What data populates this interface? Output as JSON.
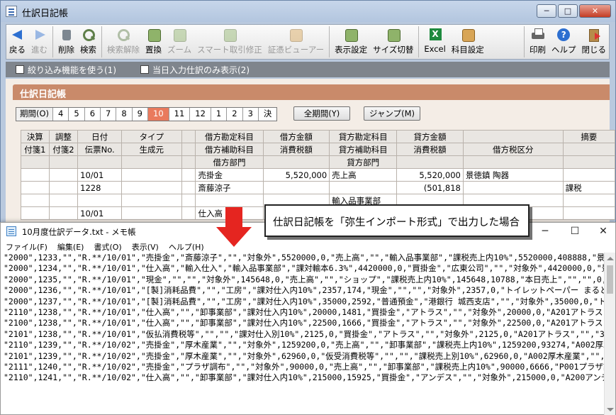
{
  "main_window": {
    "title": "仕訳日記帳",
    "controls": {
      "minimize": "─",
      "maximize": "□",
      "close": "✕"
    }
  },
  "toolbar": {
    "left": [
      {
        "label": "戻る",
        "icon": "back-arrow-icon",
        "disabled": false
      },
      {
        "label": "進む",
        "icon": "forward-arrow-icon",
        "disabled": true
      },
      {
        "label": "削除",
        "icon": "trash-icon",
        "disabled": false
      },
      {
        "label": "検索",
        "icon": "search-icon",
        "disabled": false
      },
      {
        "label": "検索解除",
        "icon": "search-clear-icon",
        "disabled": true
      },
      {
        "label": "置換",
        "icon": "replace-icon",
        "disabled": false
      },
      {
        "label": "ズーム",
        "icon": "zoom-icon",
        "disabled": true
      },
      {
        "label": "スマート取引修正",
        "icon": "smart-edit-icon",
        "disabled": true
      },
      {
        "label": "証憑ビューアー",
        "icon": "viewer-icon",
        "disabled": true
      },
      {
        "label": "表示設定",
        "icon": "display-settings-icon",
        "disabled": false
      },
      {
        "label": "サイズ切替",
        "icon": "size-toggle-icon",
        "disabled": false
      },
      {
        "label": "Excel",
        "icon": "excel-icon",
        "disabled": false
      },
      {
        "label": "科目設定",
        "icon": "account-settings-icon",
        "disabled": false
      }
    ],
    "right": [
      {
        "label": "印刷",
        "icon": "print-icon",
        "disabled": false
      },
      {
        "label": "ヘルプ",
        "icon": "help-icon",
        "disabled": false
      },
      {
        "label": "閉じる",
        "icon": "exit-icon",
        "disabled": false
      }
    ]
  },
  "options": {
    "filter": "絞り込み機能を使う(1)",
    "today_only": "当日入力仕訳のみ表示(2)"
  },
  "section_title": "仕訳日記帳",
  "periods": {
    "label": "期間(O)",
    "months": [
      "4",
      "5",
      "6",
      "7",
      "8",
      "9",
      "10",
      "11",
      "12",
      "1",
      "2",
      "3",
      "決"
    ],
    "active": "10",
    "all_button": "全期間(Y)",
    "jump_button": "ジャンプ(M)"
  },
  "ledger": {
    "header_row1": [
      "決算",
      "調整",
      "日付",
      "タイプ",
      "",
      "借方勘定科目",
      "借方金額",
      "貸方勘定科目",
      "貸方金額",
      "",
      "摘要"
    ],
    "header_row2": [
      "付箋1",
      "付箋2",
      "伝票No.",
      "生成元",
      "",
      "借方補助科目",
      "消費税額",
      "貸方補助科目",
      "消費税額",
      "借方税区分",
      ""
    ],
    "header_row3": [
      "",
      "",
      "",
      "",
      "",
      "借方部門",
      "",
      "貸方部門",
      "",
      "",
      ""
    ],
    "rows": [
      [
        "",
        "",
        "10/01",
        "",
        "",
        "売掛金",
        "5,520,000",
        "売上高",
        "5,520,000",
        "景徳鎮 陶器",
        ""
      ],
      [
        "",
        "",
        "1228",
        "",
        "",
        "斎藤涼子",
        "",
        "",
        "(501,818",
        "",
        "課税"
      ],
      [
        "",
        "",
        "",
        "",
        "",
        "",
        "",
        "輸入品事業部",
        "",
        "",
        ""
      ],
      [
        "",
        "",
        "10/01",
        "",
        "",
        "仕入高",
        "",
        "",
        "",
        "",
        ""
      ]
    ]
  },
  "callout": "仕訳日記帳を「弥生インポート形式」で出力した場合",
  "notepad": {
    "title": "10月度仕訳データ.txt - メモ帳",
    "menu": [
      "ファイル(F)",
      "編集(E)",
      "書式(O)",
      "表示(V)",
      "ヘルプ(H)"
    ],
    "controls": {
      "minimize": "─",
      "maximize": "☐",
      "close": "✕"
    },
    "lines": [
      "\"2000\",1233,\"\",\"R.**/10/01\",\"売掛金\",\"斎藤涼子\",\"\",\"対象外\",5520000,0,\"売上高\",\"\",\"輸入品事業部\",\"課税売上内10%\",5520000,408888,\"景",
      "\"2000\",1234,\"\",\"R.**/10/01\",\"仕入高\",\"輸入仕入\",\"輸入品事業部\",\"課対輸本6.3%\",4420000,0,\"買掛金\",\"広東公司\",\"\",\"対象外\",4420000,0,\"景",
      "\"2000\",1235,\"\",\"R.**/10/01\",\"現金\",\"\",\"\",\"対象外\",145648,0,\"売上高\",\"\",\"ショップ\",\"課税売上内10%\",145648,10788,\"本日売上\",\"\",\"\",0,\"\",\"\",",
      "\"2000\",1236,\"\",\"R.**/10/01\",\"[製]消耗品費\",\"\",\"工房\",\"課対仕入内10%\",2357,174,\"現金\",\"\",\"\",\"対象外\",2357,0,\"トイレットペーパー まると",
      "\"2000\",1237,\"\",\"R.**/10/01\",\"[製]消耗品費\",\"\",\"工房\",\"課対仕入内10%\",35000,2592,\"普通預金\",\"港銀行 城西支店\",\"\",\"対象外\",35000,0,\"ト",
      "\"2110\",1238,\"\",\"R.**/10/01\",\"仕入高\",\"\",\"卸事業部\",\"課対仕入内10%\",20000,1481,\"買掛金\",\"アトラス\",\"\",\"対象外\",20000,0,\"A201アトラス",
      "\"2100\",1238,\"\",\"R.**/10/01\",\"仕入高\",\"\",\"卸事業部\",\"課対仕入内10%\",22500,1666,\"買掛金\",\"アトラス\",\"\",\"対象外\",22500,0,\"A201アトラス",
      "\"2101\",1238,\"\",\"R.**/10/01\",\"仮払消費税等\",\"\",\"\",\"課対仕入別10%\",2125,0,\"買掛金\",\"アトラス\",\"\",\"対象外\",2125,0,\"A201アトラス\",\"\",\"3,\"",
      "\"2110\",1239,\"\",\"R.**/10/02\",\"売掛金\",\"厚木産業\",\"\",\"対象外\",1259200,0,\"売上高\",\"\",\"卸事業部\",\"課税売上内10%\",1259200,93274,\"A002厚木",
      "\"2101\",1239,\"\",\"R.**/10/02\",\"売掛金\",\"厚木産業\",\"\",\"対象外\",62960,0,\"仮受消費税等\",\"\",\"\",\"課税売上別10%\",62960,0,\"A002厚木産業\",\"\",",
      "\"2111\",1240,\"\",\"R.**/10/02\",\"売掛金\",\"プラザ調布\",\"\",\"対象外\",90000,0,\"売上高\",\"\",\"卸事業部\",\"課税売上内10%\",90000,6666,\"P001プラザ調",
      "\"2110\",1241,\"\",\"R.**/10/02\",\"仕入高\",\"\",\"卸事業部\",\"課対仕入内10%\",215000,15925,\"買掛金\",\"アンデス\",\"\",\"対象外\",215000,0,\"A200アンデ"
    ]
  }
}
